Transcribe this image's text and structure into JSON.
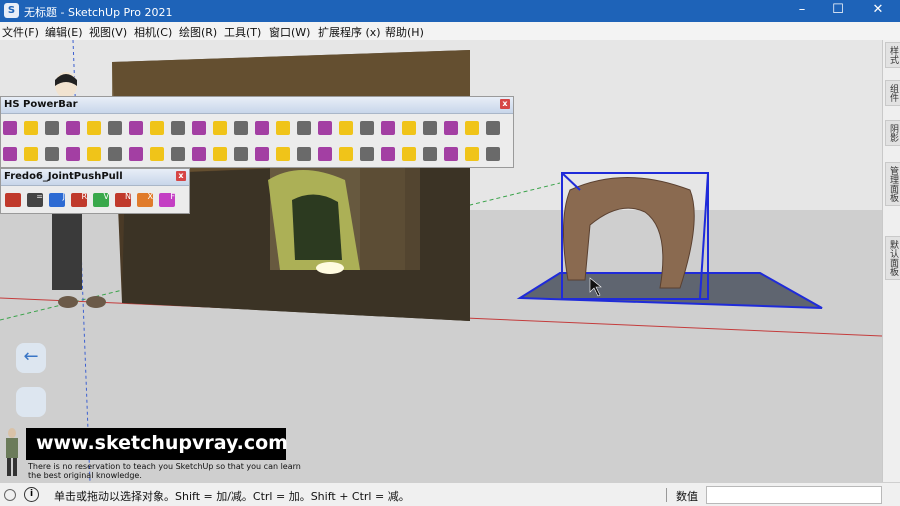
{
  "window": {
    "title": "无标题 - SketchUp Pro 2021",
    "app_icon": "sketchup-icon",
    "controls": [
      "–",
      "☐",
      "✕"
    ]
  },
  "menu": [
    "文件(F)",
    "编辑(E)",
    "视图(V)",
    "相机(C)",
    "绘图(R)",
    "工具(T)",
    "窗口(W)",
    "扩展程序 (x)",
    "帮助(H)"
  ],
  "right_panel_tabs": [
    "样式",
    "组件",
    "阴影",
    "管理面板",
    "默认面板"
  ],
  "powerbar": {
    "title": "HS PowerBar",
    "close": "x"
  },
  "fredo": {
    "title": "Fredo6_JointPushPull",
    "close": "x",
    "tools": [
      "",
      "=",
      "J",
      "R",
      "V",
      "N",
      "X",
      "F"
    ]
  },
  "watermark": {
    "site": "www.sketchupvray.com",
    "line1": "There is no reservation to teach you SketchUp so that you can learn",
    "line2": "the best original knowledge."
  },
  "nav": {
    "back_arrow": "←"
  },
  "status": {
    "hint": "单击或拖动以选择对象。Shift = 加/减。Ctrl = 加。Shift + Ctrl = 减。",
    "measure_label": "数值",
    "measure_value": ""
  },
  "colors": {
    "titlebar": "#1e63b8",
    "selection": "#1f2bd9",
    "axis_red": "#c43c3c",
    "axis_green": "#3aa34a",
    "axis_blue": "#3b5fd0"
  }
}
